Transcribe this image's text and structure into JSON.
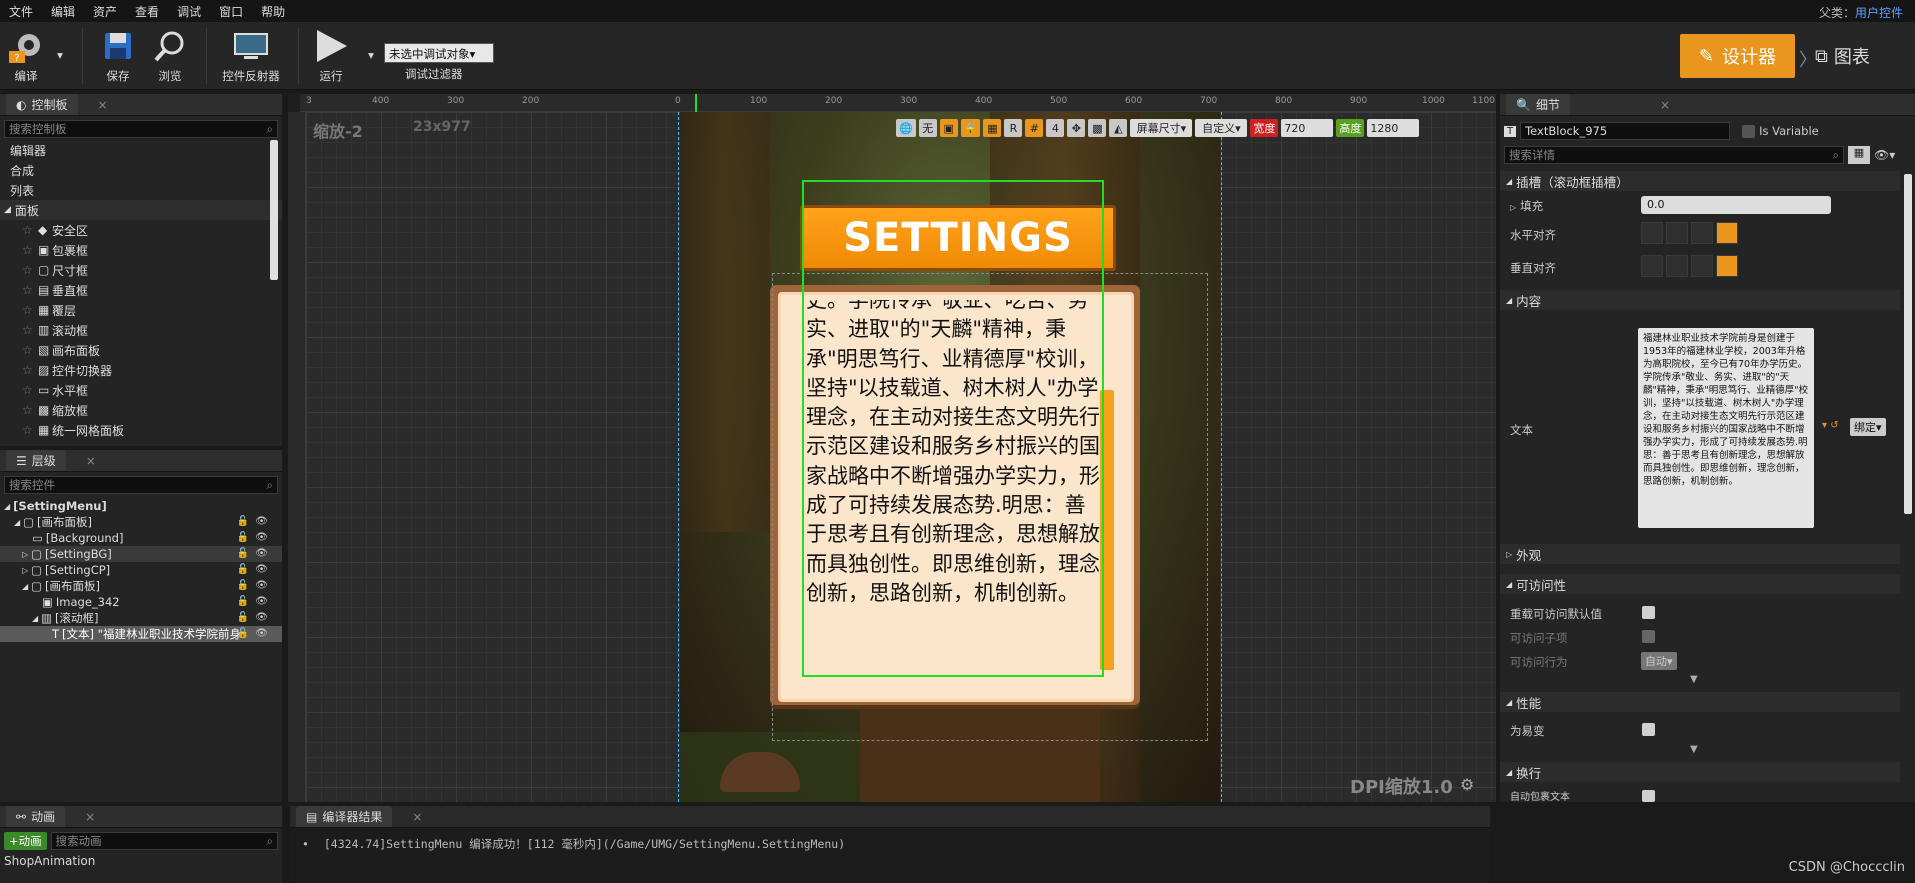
{
  "menu": [
    "文件",
    "编辑",
    "资产",
    "查看",
    "调试",
    "窗口",
    "帮助"
  ],
  "parent_class": {
    "label": "父类：",
    "value": "用户控件"
  },
  "toolbar": {
    "compile": "编译",
    "save": "保存",
    "browse": "浏览",
    "reflector": "控件反射器",
    "run": "运行",
    "debug_object": "未选中调试对象▾",
    "debug_filter": "调试过滤器"
  },
  "mode": {
    "designer": "设计器",
    "graph": "图表"
  },
  "palette": {
    "title": "控制板",
    "search_placeholder": "搜索控制板",
    "categories": [
      "编辑器",
      "合成",
      "列表",
      "面板"
    ],
    "panel_items": [
      "安全区",
      "包裹框",
      "尺寸框",
      "垂直框",
      "覆层",
      "滚动框",
      "画布面板",
      "控件切换器",
      "水平框",
      "缩放框",
      "统一网格面板"
    ]
  },
  "hierarchy": {
    "title": "层级",
    "search_placeholder": "搜索控件",
    "items": [
      {
        "label": "[SettingMenu]",
        "indent": 0
      },
      {
        "label": "[画布面板]",
        "indent": 1
      },
      {
        "label": "[Background]",
        "indent": 2
      },
      {
        "label": "[SettingBG]",
        "indent": 2
      },
      {
        "label": "[SettingCP]",
        "indent": 2
      },
      {
        "label": "[画布面板]",
        "indent": 2
      },
      {
        "label": "Image_342",
        "indent": 3
      },
      {
        "label": "[滚动框]",
        "indent": 3
      },
      {
        "label": "[文本] \"福建林业职业技术学院前身",
        "indent": 4
      }
    ]
  },
  "animation": {
    "title": "动画",
    "add_button": "+动画",
    "search_placeholder": "搜索动画",
    "items": [
      "ShopAnimation"
    ]
  },
  "compiler": {
    "title": "编译器结果",
    "message": "[4324.74]SettingMenu 编译成功！[112 毫秒内](/Game/UMG/SettingMenu.SettingMenu)"
  },
  "canvas": {
    "zoom": "缩放-2",
    "size": "23x977",
    "dpi": "DPI缩放1.0",
    "ruler_top": [
      "3",
      "400",
      "300",
      "200",
      "0",
      "100",
      "200",
      "300",
      "400",
      "500",
      "600",
      "700",
      "800",
      "900",
      "1000",
      "1100"
    ],
    "screen_size": "屏幕尺寸▾",
    "custom": "自定义▾",
    "width_label": "宽度",
    "width_value": "720",
    "height_label": "高度",
    "height_value": "1280",
    "no_label": "无",
    "r_label": "R",
    "four_label": "4"
  },
  "preview": {
    "banner": "SETTINGS",
    "body": "史。学院传承\"敬业、吃苦、务实、进取\"的\"天麟\"精神，秉承\"明思笃行、业精德厚\"校训，坚持\"以技载道、树木树人\"办学理念，在主动对接生态文明先行示范区建设和服务乡村振兴的国家战略中不断增强办学实力，形成了可持续发展态势.明思：善于思考且有创新理念，思想解放而具独创性。即思维创新，理念创新，思路创新，机制创新。"
  },
  "details": {
    "title": "细节",
    "name": "TextBlock_975",
    "is_variable": "Is Variable",
    "search_placeholder": "搜索详情",
    "slot_category": "插槽（滚动框插槽）",
    "padding_label": "填充",
    "padding_value": "0.0",
    "halign_label": "水平对齐",
    "valign_label": "垂直对齐",
    "content_category": "内容",
    "text_label": "文本",
    "text_value": "福建林业职业技术学院前身是创建于1953年的福建林业学校，2003年升格为高职院校，至今已有70年办学历史。学院传承\"敬业、务实、进取\"的\"天麟\"精神，秉承\"明思笃行、业精德厚\"校训，坚持\"以技载道、树木树人\"办学理念，在主动对接生态文明先行示范区建设和服务乡村振兴的国家战略中不断增强办学实力，形成了可持续发展态势.明思：善于思考且有创新理念，思想解放而具独创性。即思维创新，理念创新，思路创新，机制创新。",
    "bind": "绑定▾",
    "appearance_category": "外观",
    "accessibility_category": "可访问性",
    "override_access": "重载可访问默认值",
    "access_children": "可访问子项",
    "access_behavior": "可访问行为",
    "access_behavior_value": "自动▾",
    "performance_category": "性能",
    "volatile": "为易变",
    "wrap_category": "换行",
    "auto_wrap": "自动包裹文本"
  },
  "watermark": "CSDN @Choccclin"
}
